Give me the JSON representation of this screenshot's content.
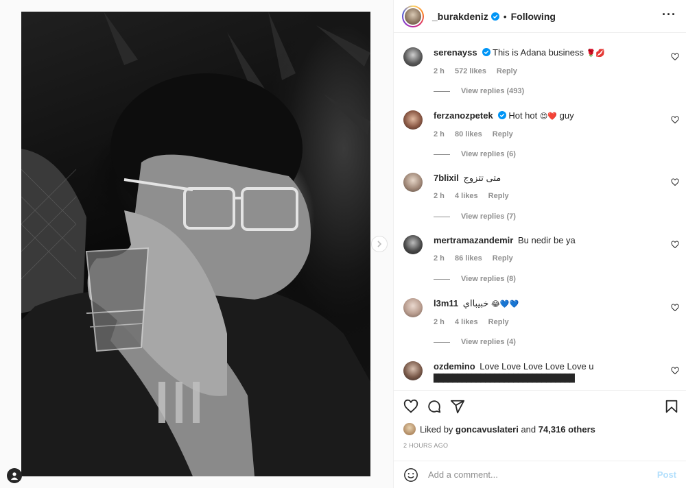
{
  "header": {
    "username": "_burakdeniz",
    "separator": "•",
    "follow_status": "Following",
    "more": "···"
  },
  "comments": [
    {
      "user": "serenayss",
      "verified": true,
      "text": "This is Adana business",
      "emoji": "🌹💋",
      "time": "2 h",
      "likes": "572 likes",
      "reply": "Reply",
      "replies": "View replies (493)"
    },
    {
      "user": "ferzanozpetek",
      "verified": true,
      "text": "Hot hot",
      "emoji": "😍❤️",
      "text2": "guy",
      "time": "2 h",
      "likes": "80 likes",
      "reply": "Reply",
      "replies": "View replies (6)"
    },
    {
      "user": "7blixil",
      "verified": false,
      "text": "متى تتزوج",
      "time": "2 h",
      "likes": "4 likes",
      "reply": "Reply",
      "replies": "View replies (7)"
    },
    {
      "user": "mertramazandemir",
      "verified": false,
      "text": "Bu nedir be ya",
      "time": "2 h",
      "likes": "86 likes",
      "reply": "Reply",
      "replies": "View replies (8)"
    },
    {
      "user": "l3m11",
      "verified": false,
      "text": "خبيبااي",
      "emoji": "😂💙💙",
      "time": "2 h",
      "likes": "4 likes",
      "reply": "Reply",
      "replies": "View replies (4)"
    },
    {
      "user": "ozdemino",
      "verified": false,
      "text": "Love Love Love Love Love u",
      "blocks": "▇▇▇▇▇▇▇▇▇▇▇▇▇▇▇▇▇▇▇▇▇▇▇▇▇▇▇▇▇▇"
    }
  ],
  "likes": {
    "prefix": "Liked by",
    "user": "goncavuslateri",
    "and": "and",
    "others": "74,316 others"
  },
  "timestamp": "2 HOURS AGO",
  "add_comment": {
    "placeholder": "Add a comment...",
    "post": "Post"
  },
  "colors": {
    "verified": "#0095f6",
    "muted": "#8e8e8e",
    "post_disabled": "#b2dffc"
  }
}
